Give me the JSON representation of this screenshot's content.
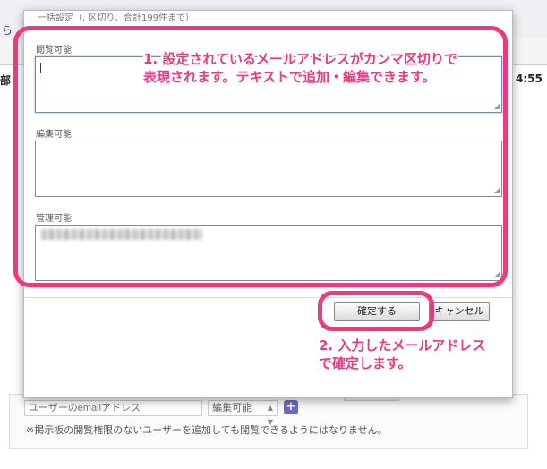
{
  "background": {
    "edge_text_left_top": "ら",
    "edge_text_left_mid": "部",
    "edge_text_right": "4:55",
    "email_input_placeholder": "ユーザーのemailアドレス",
    "permission_select_value": "編集可能",
    "plus_label": "+",
    "note": "※掲示板の閲覧権限のないユーザーを追加しても閲覧できるようにはなりません。"
  },
  "dialog": {
    "header_text": "一括設定（, 区切り、合計199件まで）",
    "sections": [
      {
        "label": "閲覧可能",
        "value": ""
      },
      {
        "label": "編集可能",
        "value": ""
      },
      {
        "label": "管理可能",
        "value": ""
      }
    ],
    "confirm_label": "確定する",
    "cancel_label": "キャンセル"
  },
  "annotations": {
    "callout_1_line1": "1. 設定されているメールアドレスがカンマ区切りで",
    "callout_1_line2": "表現されます。テキストで追加・編集できます。",
    "callout_2_line1": "2. 入力したメールアドレス",
    "callout_2_line2": "で確定します。",
    "highlight_color": "#ee3a7d"
  }
}
